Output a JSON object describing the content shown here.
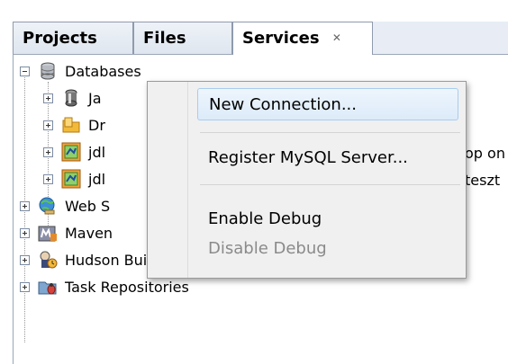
{
  "tabs": [
    {
      "label": "Projects",
      "active": false
    },
    {
      "label": "Files",
      "active": false
    },
    {
      "label": "Services",
      "active": true,
      "close": "✕"
    }
  ],
  "tree": {
    "databases": {
      "label": "Databases"
    },
    "db_children": [
      {
        "label": "Ja",
        "icon": "java-db-icon"
      },
      {
        "label": "Dr",
        "icon": "drivers-folder-icon"
      },
      {
        "label": "jdl",
        "icon": "db-connection-icon"
      },
      {
        "label": "jdl",
        "icon": "db-connection-icon"
      }
    ],
    "web_services": {
      "label": "Web S"
    },
    "maven": {
      "label": "Maven"
    },
    "hudson": {
      "label": "Hudson Builders"
    },
    "task_repos": {
      "label": "Task Repositories"
    }
  },
  "behind_text": [
    "op on",
    "teszt"
  ],
  "context_menu": {
    "items": [
      {
        "label": "New Connection...",
        "state": "hover"
      },
      {
        "label": "Register MySQL Server...",
        "state": "normal"
      },
      {
        "label": "Enable Debug",
        "state": "normal"
      },
      {
        "label": "Disable Debug",
        "state": "disabled"
      }
    ]
  },
  "colors": {
    "accent": "#a8cdf0",
    "tab_bg": "#e8edf5"
  }
}
